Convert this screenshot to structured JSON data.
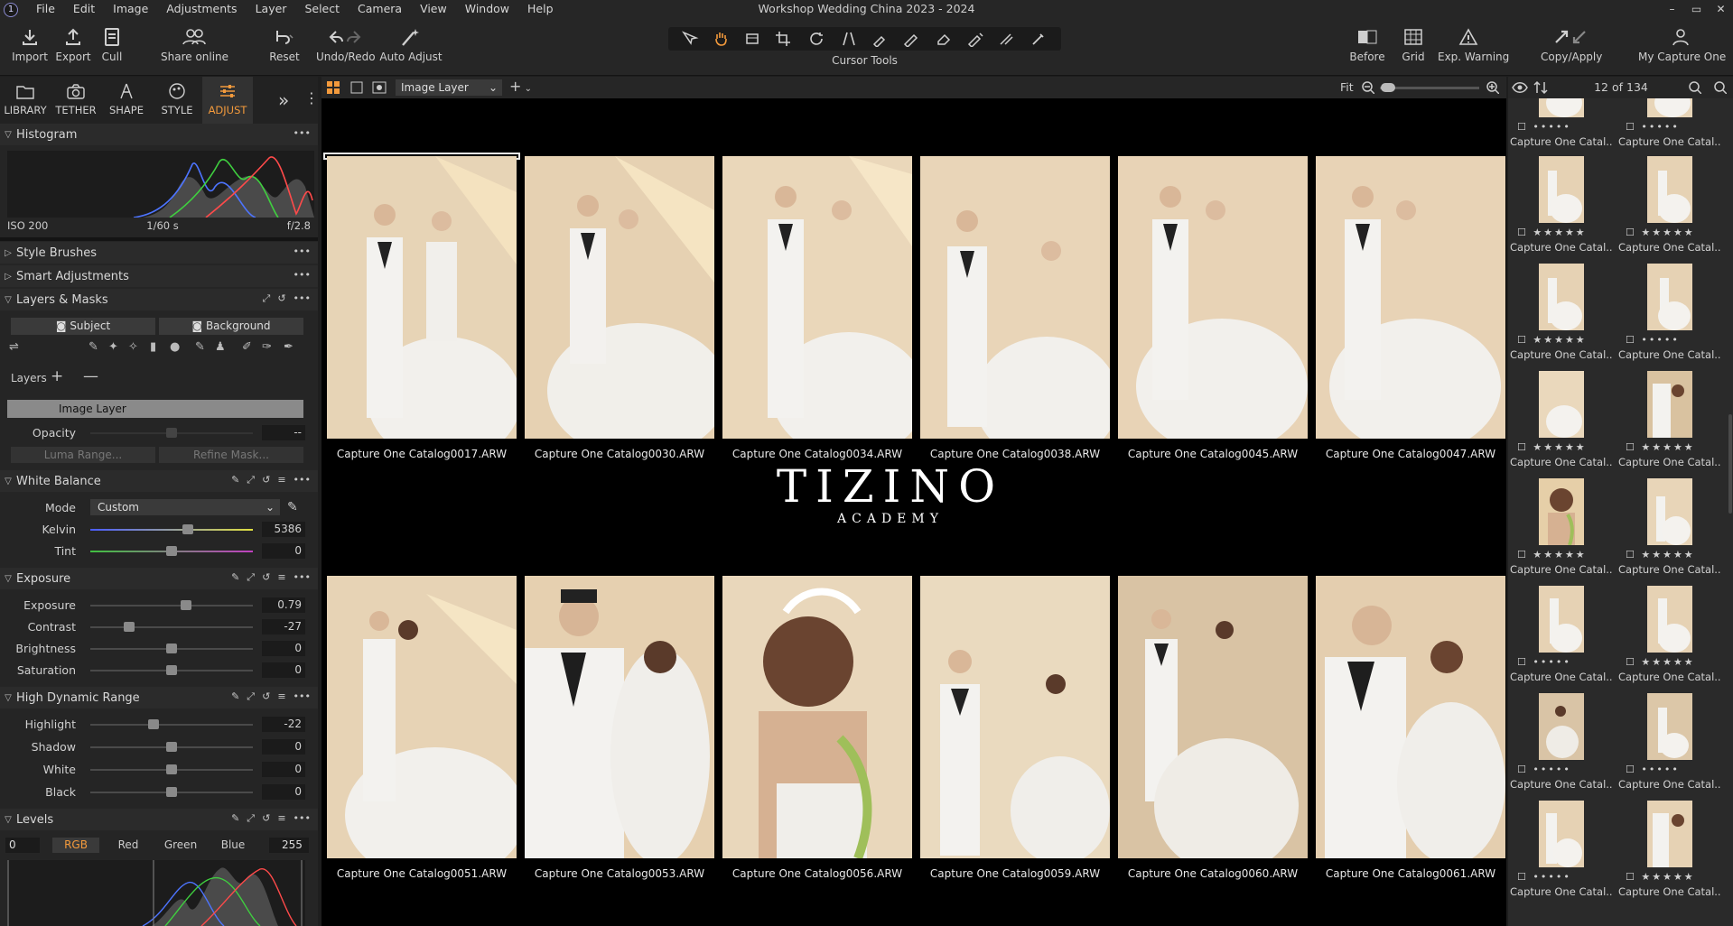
{
  "app": {
    "window_title": "Workshop Wedding China 2023 - 2024",
    "logo_glyph": "1",
    "menu": [
      "File",
      "Edit",
      "Image",
      "Adjustments",
      "Layer",
      "Select",
      "Camera",
      "View",
      "Window",
      "Help"
    ],
    "window_controls": [
      "–",
      "▭",
      "✕"
    ]
  },
  "toolbar": {
    "import": "Import",
    "export": "Export",
    "cull": "Cull",
    "share": "Share online",
    "reset": "Reset",
    "undo_redo": "Undo/Redo",
    "auto_adjust": "Auto Adjust",
    "cursor_tools": "Cursor Tools",
    "before": "Before",
    "grid": "Grid",
    "exp_warning": "Exp. Warning",
    "copy_apply": "Copy/Apply",
    "my_capture_one": "My Capture One"
  },
  "tool_tabs": [
    {
      "label": "LIBRARY",
      "icon": "library-icon"
    },
    {
      "label": "TETHER",
      "icon": "camera-icon"
    },
    {
      "label": "SHAPE",
      "icon": "shape-icon"
    },
    {
      "label": "STYLE",
      "icon": "style-icon"
    },
    {
      "label": "ADJUST",
      "icon": "adjust-icon",
      "active": true
    }
  ],
  "histogram": {
    "title": "Histogram",
    "iso": "ISO 200",
    "shutter": "1/60 s",
    "aperture": "f/2.8"
  },
  "sections": {
    "style_brushes": "Style Brushes",
    "smart_adjustments": "Smart Adjustments",
    "layers_masks": "Layers & Masks",
    "white_balance": "White Balance",
    "exposure": "Exposure",
    "hdr": "High Dynamic Range",
    "levels": "Levels"
  },
  "layers": {
    "subject_button": "Subject",
    "background_button": "Background",
    "layers_label": "Layers",
    "active_layer": "Image Layer",
    "opacity_label": "Opacity",
    "opacity_value": "--",
    "opacity_level": 50,
    "luma_range": "Luma Range...",
    "refine_mask": "Refine Mask..."
  },
  "white_balance": {
    "mode_label": "Mode",
    "mode_value": "Custom",
    "kelvin_label": "Kelvin",
    "kelvin_value": "5386",
    "kelvin_level": 60,
    "tint_label": "Tint",
    "tint_value": "0",
    "tint_level": 50
  },
  "exposure": [
    {
      "label": "Exposure",
      "value": "0.79",
      "level": 59
    },
    {
      "label": "Contrast",
      "value": "-27",
      "level": 24
    },
    {
      "label": "Brightness",
      "value": "0",
      "level": 50
    },
    {
      "label": "Saturation",
      "value": "0",
      "level": 50
    }
  ],
  "hdr": [
    {
      "label": "Highlight",
      "value": "-22",
      "level": 39
    },
    {
      "label": "Shadow",
      "value": "0",
      "level": 50
    },
    {
      "label": "White",
      "value": "0",
      "level": 50
    },
    {
      "label": "Black",
      "value": "0",
      "level": 50
    }
  ],
  "levels": {
    "low": "0",
    "high": "255",
    "channels": [
      "RGB",
      "Red",
      "Green",
      "Blue"
    ],
    "active_channel": "RGB"
  },
  "viewer": {
    "layer_select": "Image Layer",
    "fit_label": "Fit",
    "watermark_title": "TIZINO",
    "watermark_sub": "ACADEMY"
  },
  "thumbnails": [
    {
      "name": "Capture One Catalog0017.ARW",
      "selected": true
    },
    {
      "name": "Capture One Catalog0030.ARW"
    },
    {
      "name": "Capture One Catalog0034.ARW"
    },
    {
      "name": "Capture One Catalog0038.ARW"
    },
    {
      "name": "Capture One Catalog0045.ARW"
    },
    {
      "name": "Capture One Catalog0047.ARW"
    },
    {
      "name": "Capture One Catalog0051.ARW"
    },
    {
      "name": "Capture One Catalog0053.ARW"
    },
    {
      "name": "Capture One Catalog0056.ARW"
    },
    {
      "name": "Capture One Catalog0059.ARW"
    },
    {
      "name": "Capture One Catalog0060.ARW"
    },
    {
      "name": "Capture One Catalog0061.ARW"
    }
  ],
  "browser": {
    "count": "12 of 134",
    "item_label": "Capture One Catal...",
    "rows": [
      [
        "•••••",
        "•••••"
      ],
      [
        "★★★★★",
        "★★★★★"
      ],
      [
        "★★★★★",
        "•••••"
      ],
      [
        "★★★★★",
        "★★★★★"
      ],
      [
        "★★★★★",
        "★★★★★"
      ],
      [
        "•••••",
        "★★★★★"
      ],
      [
        "•••••",
        "•••••"
      ],
      [
        "•••••",
        "★★★★★"
      ]
    ]
  }
}
